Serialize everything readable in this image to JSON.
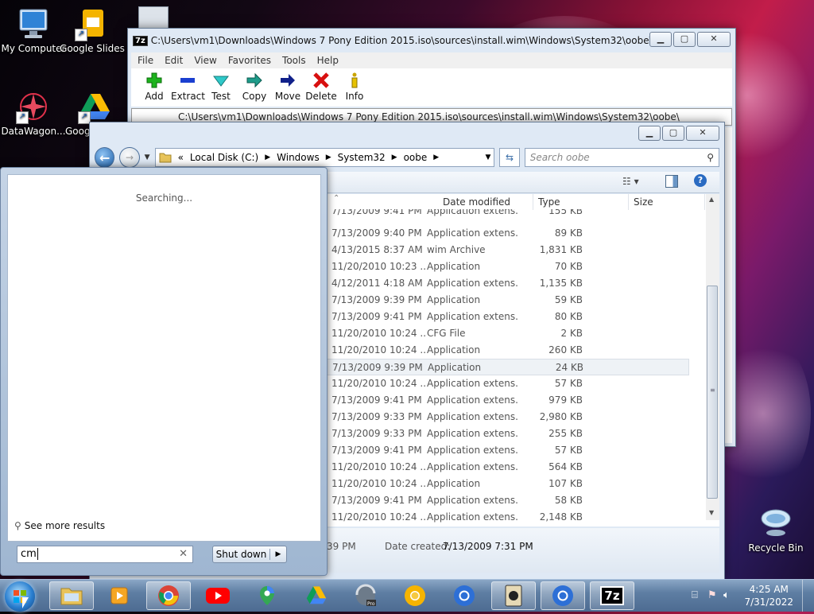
{
  "desktop": {
    "icons": [
      {
        "label": "My Computer"
      },
      {
        "label": "Google Slides"
      },
      {
        "label": "DataWagon..."
      },
      {
        "label": "Goog"
      },
      {
        "label": "Recycle Bin"
      }
    ]
  },
  "sevenzip": {
    "title": "C:\\Users\\vm1\\Downloads\\Windows 7 Pony Edition 2015.iso\\sources\\install.wim\\Windows\\System32\\oobe\\",
    "logo": "7z",
    "menu": [
      "File",
      "Edit",
      "View",
      "Favorites",
      "Tools",
      "Help"
    ],
    "toolbar": [
      "Add",
      "Extract",
      "Test",
      "Copy",
      "Move",
      "Delete",
      "Info"
    ],
    "address": "C:\\Users\\vm1\\Downloads\\Windows 7 Pony Edition 2015.iso\\sources\\install.wim\\Windows\\System32\\oobe\\"
  },
  "explorer": {
    "breadcrumb": [
      "Local Disk (C:)",
      "Windows",
      "System32",
      "oobe"
    ],
    "search_placeholder": "Search oobe",
    "columns": [
      "Date modified",
      "Type",
      "Size"
    ],
    "rows": [
      {
        "date": "7/13/2009 9:41 PM",
        "type": "Application extens...",
        "size": "155 KB"
      },
      {
        "date": "7/13/2009 9:40 PM",
        "type": "Application extens...",
        "size": "89 KB"
      },
      {
        "date": "4/13/2015 8:37 AM",
        "type": "wim Archive",
        "size": "1,831 KB"
      },
      {
        "date": "11/20/2010 10:23 ...",
        "type": "Application",
        "size": "70 KB"
      },
      {
        "date": "4/12/2011 4:18 AM",
        "type": "Application extens...",
        "size": "1,135 KB"
      },
      {
        "date": "7/13/2009 9:39 PM",
        "type": "Application",
        "size": "59 KB"
      },
      {
        "date": "7/13/2009 9:41 PM",
        "type": "Application extens...",
        "size": "80 KB"
      },
      {
        "date": "11/20/2010 10:24 ...",
        "type": "CFG File",
        "size": "2 KB"
      },
      {
        "date": "11/20/2010 10:24 ...",
        "type": "Application",
        "size": "260 KB"
      },
      {
        "date": "7/13/2009 9:39 PM",
        "type": "Application",
        "size": "24 KB"
      },
      {
        "date": "11/20/2010 10:24 ...",
        "type": "Application extens...",
        "size": "57 KB"
      },
      {
        "date": "7/13/2009 9:41 PM",
        "type": "Application extens...",
        "size": "979 KB"
      },
      {
        "date": "7/13/2009 9:33 PM",
        "type": "Application extens...",
        "size": "2,980 KB"
      },
      {
        "date": "7/13/2009 9:33 PM",
        "type": "Application extens...",
        "size": "255 KB"
      },
      {
        "date": "7/13/2009 9:41 PM",
        "type": "Application extens...",
        "size": "57 KB"
      },
      {
        "date": "11/20/2010 10:24 ...",
        "type": "Application extens...",
        "size": "564 KB"
      },
      {
        "date": "11/20/2010 10:24 ...",
        "type": "Application",
        "size": "107 KB"
      },
      {
        "date": "7/13/2009 9:41 PM",
        "type": "Application extens...",
        "size": "58 KB"
      },
      {
        "date": "11/20/2010 10:24 ...",
        "type": "Application extens...",
        "size": "2,148 KB"
      }
    ],
    "details": {
      "left_value": "39 PM",
      "created_label": "Date created:",
      "created_value": "7/13/2009 7:31 PM"
    }
  },
  "start_menu": {
    "status": "Searching...",
    "see_more": "See more results",
    "search_value": "cm",
    "shutdown_label": "Shut down"
  },
  "taskbar": {
    "clock_time": "4:25 AM",
    "clock_date": "7/31/2022",
    "tray_7z": "7z"
  }
}
